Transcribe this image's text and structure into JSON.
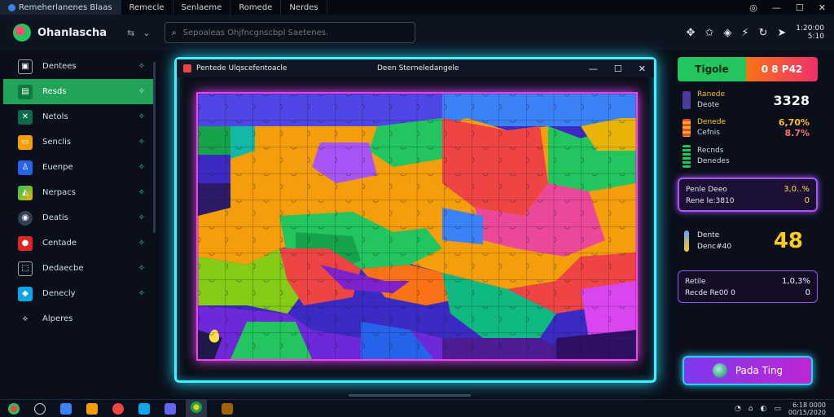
{
  "colors": {
    "accent": "#22a35a",
    "neon_cyan": "#3ff0ff",
    "neon_magenta": "#ff3df0",
    "background": "#0a0f1a"
  },
  "tabs": [
    {
      "label": "Remeherlanenes Blaas",
      "icon": "app-icon"
    },
    {
      "label": "Remecle",
      "icon": "tab-icon"
    },
    {
      "label": "Senlaeme",
      "icon": "tab-icon"
    },
    {
      "label": "Romede",
      "icon": "tab-icon"
    },
    {
      "label": "Nerdes",
      "icon": "tab-icon"
    }
  ],
  "header": {
    "app_name": "Ohanlascha",
    "search_placeholder": "Sepoaleas Ohjfncgnscbpl Saetenes.",
    "clock_line1": "1:20:00",
    "clock_line2": "5:10"
  },
  "sidebar": {
    "items": [
      {
        "label": "Dentees",
        "icon": "image-icon"
      },
      {
        "label": "Resds",
        "icon": "document-icon",
        "active": true
      },
      {
        "label": "Netols",
        "icon": "x-icon"
      },
      {
        "label": "Senclis",
        "icon": "note-icon"
      },
      {
        "label": "Euenpe",
        "icon": "person-icon"
      },
      {
        "label": "Nerpacs",
        "icon": "map-icon"
      },
      {
        "label": "Deatis",
        "icon": "circle-icon"
      },
      {
        "label": "Centade",
        "icon": "record-icon"
      },
      {
        "label": "Dedaecbe",
        "icon": "box-icon"
      },
      {
        "label": "Denecly",
        "icon": "drop-icon"
      },
      {
        "label": "Alperes",
        "icon": "settings-icon"
      }
    ]
  },
  "game_window": {
    "title_left": "Pentede Ulqscefentoacle",
    "title_center": "Deen Sterneledangele"
  },
  "right_panel": {
    "score_left": "Tigole",
    "score_right": "0 8 P42",
    "stat1_label1": "Ranede",
    "stat1_label2": "Deote",
    "stat1_value": "3328",
    "stat2_label1": "Denede",
    "stat2_label2": "Cefnis",
    "stat2_value1": "6,70%",
    "stat2_value2": "8.7%",
    "stat3_label1": "Recnds",
    "stat3_label2": "Denedes",
    "card1_label1": "Penle Deeo",
    "card1_label2": "Rene le:3810",
    "card1_value1": "3,0..%",
    "card1_value2": "0",
    "card2_label1": "Dente",
    "card2_label2": "Denc#40",
    "card2_value": "48",
    "card3_label1": "Retile",
    "card3_label2": "Recde Re00 0",
    "card3_value1": "1,0,3%",
    "card3_value2": "0",
    "play_button": "Pada Ting"
  },
  "taskbar": {
    "tray_line1": "6:18 0000",
    "tray_line2": "00/15/2020"
  }
}
